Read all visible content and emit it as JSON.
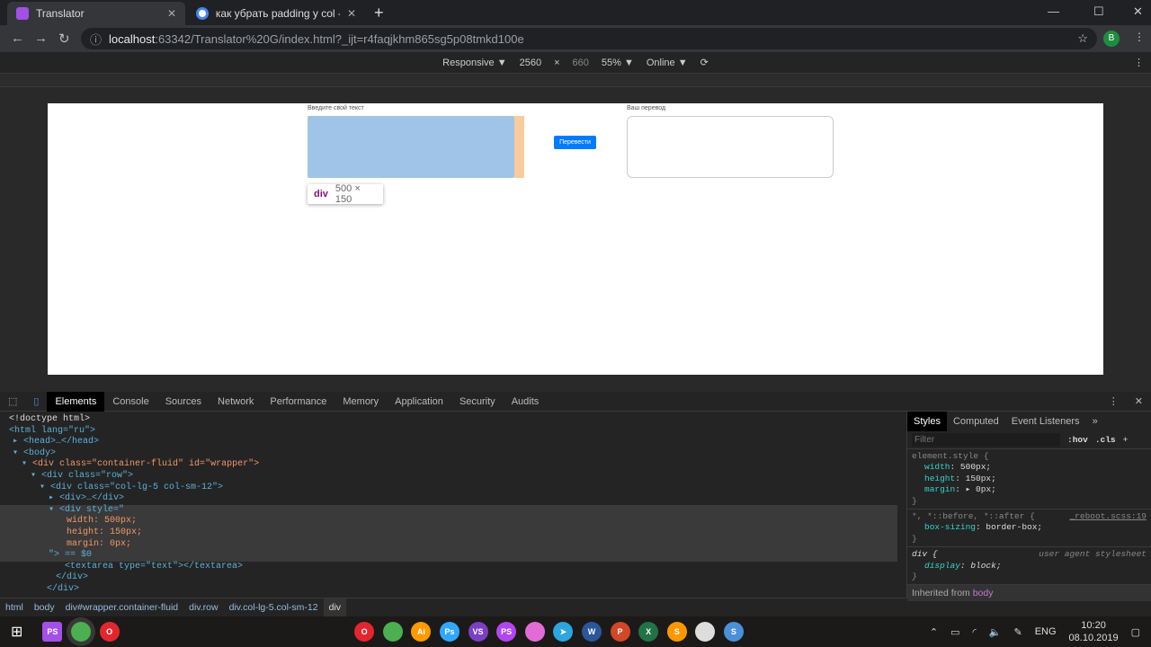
{
  "browser": {
    "tabs": [
      {
        "title": "Translator"
      },
      {
        "title": "как убрать padding у col - Поис"
      }
    ],
    "url_host": "localhost",
    "url_rest": ":63342/Translator%20G/index.html?_ijt=r4faqjkhm865sg5p08tmkd100e",
    "profile": "B"
  },
  "device_toolbar": {
    "mode": "Responsive ▼",
    "width": "2560",
    "times": "×",
    "height": "660",
    "zoom": "55% ▼",
    "network": "Online ▼"
  },
  "page": {
    "input_label": "Введите свой текст",
    "button": "Перевести",
    "output_label": "Ваш перевод",
    "tooltip_tag": "div",
    "tooltip_size": "500 × 150"
  },
  "devtools": {
    "tabs": [
      "Elements",
      "Console",
      "Sources",
      "Network",
      "Performance",
      "Memory",
      "Application",
      "Security",
      "Audits"
    ],
    "styles_tabs": [
      "Styles",
      "Computed",
      "Event Listeners",
      "»"
    ],
    "filter_placeholder": "Filter",
    "hov": ":hov",
    "cls": ".cls",
    "rules": {
      "r1_sel": "element.style {",
      "w": "width",
      "wv": "500px;",
      "h": "height",
      "hv": "150px;",
      "m": "margin",
      "mv": "▸ 0px;",
      "close": "}",
      "r2_sel": "*, *::before, *::after {",
      "r2_src": "_reboot.scss:19",
      "bs": "box-sizing",
      "bsv": "border-box;",
      "r3_sel": "div {",
      "r3_src": "user agent stylesheet",
      "d": "display",
      "dv": "block;",
      "inherited": "Inherited from",
      "inh_el": "body"
    },
    "dom": [
      "<!doctype html>",
      "<html lang=\"ru\">",
      "<head>…</head>",
      "<body>",
      "<div class=\"container-fluid\" id=\"wrapper\">",
      "<div class=\"row\">",
      "<div class=\"col-lg-5 col-sm-12\">",
      "<div>…</div>",
      "<div style=\"",
      "width: 500px;",
      "height: 150px;",
      "margin: 0px;",
      "\"> == $0",
      "<textarea type=\"text\"></textarea>",
      "</div>",
      "</div>"
    ],
    "breadcrumbs": [
      "html",
      "body",
      "div#wrapper.container-fluid",
      "div.row",
      "div.col-lg-5.col-sm-12",
      "div"
    ]
  },
  "taskbar": {
    "lang": "ENG",
    "time": "10:20",
    "date": "08.10.2019",
    "apps": [
      {
        "n": "opera",
        "l": "O",
        "c": "#e3262e"
      },
      {
        "n": "chrome",
        "l": "",
        "c": "#4caf50"
      },
      {
        "n": "illustrator",
        "l": "Ai",
        "c": "#ff9a00"
      },
      {
        "n": "photoshop",
        "l": "Ps",
        "c": "#31a8ff"
      },
      {
        "n": "visual-studio",
        "l": "VS",
        "c": "#7b3fc4"
      },
      {
        "n": "phpstorm",
        "l": "PS",
        "c": "#b345f1"
      },
      {
        "n": "app",
        "l": "",
        "c": "#e26bd6"
      },
      {
        "n": "telegram",
        "l": "➤",
        "c": "#2ca5e0"
      },
      {
        "n": "word",
        "l": "W",
        "c": "#2b579a"
      },
      {
        "n": "powerpoint",
        "l": "P",
        "c": "#d24726"
      },
      {
        "n": "excel",
        "l": "X",
        "c": "#217346"
      },
      {
        "n": "sublime",
        "l": "S",
        "c": "#ff9800"
      },
      {
        "n": "app2",
        "l": "",
        "c": "#ddd"
      },
      {
        "n": "app3",
        "l": "S",
        "c": "#4a90d9"
      }
    ]
  }
}
